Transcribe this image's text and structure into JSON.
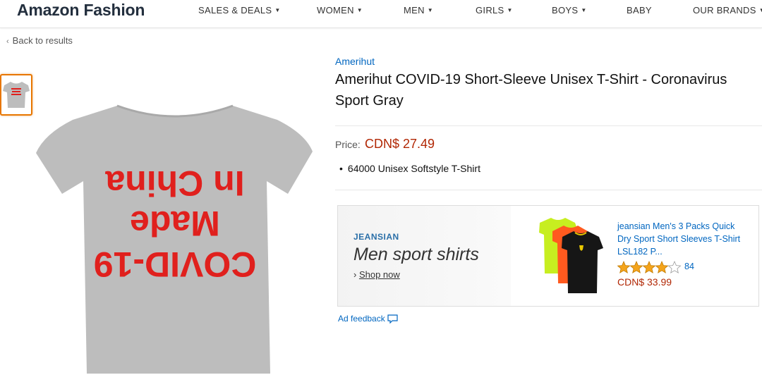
{
  "header": {
    "brand": "Amazon Fashion",
    "nav": [
      {
        "label": "SALES & DEALS",
        "has_caret": true
      },
      {
        "label": "WOMEN",
        "has_caret": true
      },
      {
        "label": "MEN",
        "has_caret": true
      },
      {
        "label": "GIRLS",
        "has_caret": true
      },
      {
        "label": "BOYS",
        "has_caret": true
      },
      {
        "label": "BABY",
        "has_caret": false
      },
      {
        "label": "OUR BRANDS",
        "has_caret": true
      }
    ]
  },
  "breadcrumb": {
    "back_label": "Back to results"
  },
  "gallery": {
    "shirt_color": "#bdbdbd",
    "print_color": "#e0201d",
    "print_lines": [
      "COVID-19",
      "Made",
      "In China"
    ]
  },
  "product": {
    "seller": "Amerihut",
    "title": "Amerihut COVID-19 Short-Sleeve Unisex T-Shirt - Coronavirus Sport Gray",
    "price_label": "Price:",
    "price": "CDN$ 27.49",
    "bullets": [
      "64000 Unisex Softstyle T-Shirt"
    ]
  },
  "ad": {
    "brand": "JEANSIAN",
    "headline": "Men sport shirts",
    "shop_label": "Shop now",
    "product_title": "jeansian Men's 3 Packs Quick Dry Sport Short Sleeves T-Shirt LSL182 P...",
    "rating": 4,
    "review_count": "84",
    "price": "CDN$ 33.99",
    "feedback_label": "Ad feedback"
  },
  "colors": {
    "accent_orange": "#e77600",
    "link_blue": "#0066c0",
    "price_red": "#b12704",
    "star_gold": "#f4a41c"
  }
}
